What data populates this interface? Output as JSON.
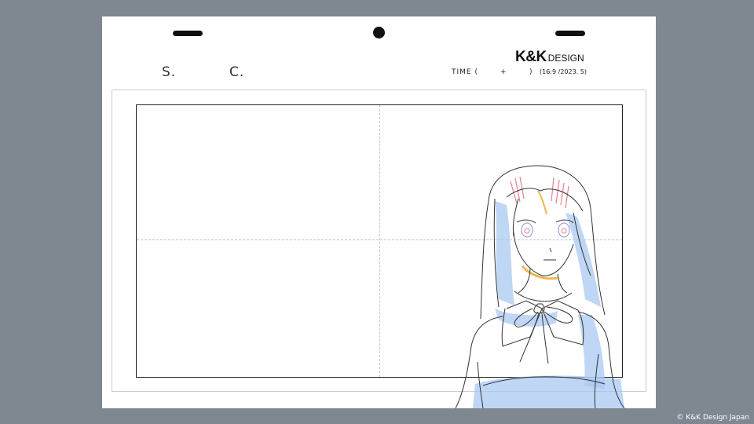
{
  "sheet": {
    "scene_label": "S.",
    "cut_label": "C.",
    "brand_name": "K&K",
    "brand_suffix": "DESIGN",
    "time_label": "TIME (",
    "time_plus": "+",
    "time_close": ")",
    "format_note": "(16:9 /2023. 5)"
  },
  "illustration": {
    "line_color": "#333333",
    "shadow_color": "#a9c8f2",
    "accent_red": "#e77f8c",
    "accent_orange": "#f0b64c"
  },
  "copyright": "© K&K Design Japan"
}
